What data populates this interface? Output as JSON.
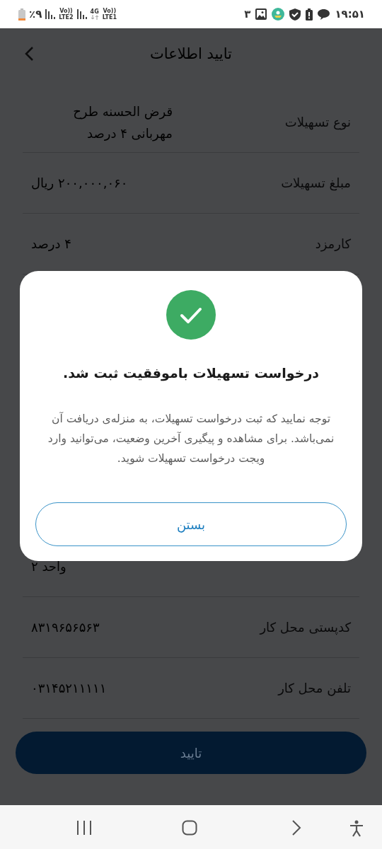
{
  "status_bar": {
    "battery": "٪۹",
    "sim2": {
      "volte": "Vo))",
      "network": "LTE2"
    },
    "sim1": {
      "network": "4G",
      "volte": "Vo))",
      "lte": "LTE1"
    },
    "notification_count": "۳",
    "time": "۱۹:۵۱"
  },
  "header": {
    "title": "تایید اطلاعات"
  },
  "rows_above": [
    {
      "label": "نوع تسهیلات",
      "value": "قرض الحسنه طرح مهربانی ۴ درصد"
    },
    {
      "label": "مبلغ تسهیلات",
      "value": "۲۰۰,۰۰۰,۰۶۰ ریال"
    },
    {
      "label": "کارمزد",
      "value": "۴ درصد"
    }
  ],
  "rows_below": [
    {
      "value": "واحد ۲"
    },
    {
      "label": "کدپستی محل کار",
      "value": "۸۳۱۹۶۵۶۵۶۳"
    },
    {
      "label": "تلفن محل کار",
      "value": "۰۳۱۴۵۲۱۱۱۱۱"
    }
  ],
  "confirm_button": {
    "label": "تایید"
  },
  "dialog": {
    "title": "درخواست تسهیلات باموفقیت ثبت شد.",
    "message": "توجه نمایید که ثبت درخواست تسهیلات، به منزله‌ی دریافت آن نمی‌باشد. برای مشاهده و پیگیری آخرین وضعیت، می‌توانید وارد ویجت درخواست تسهیلات شوید.",
    "button": "بستن"
  }
}
